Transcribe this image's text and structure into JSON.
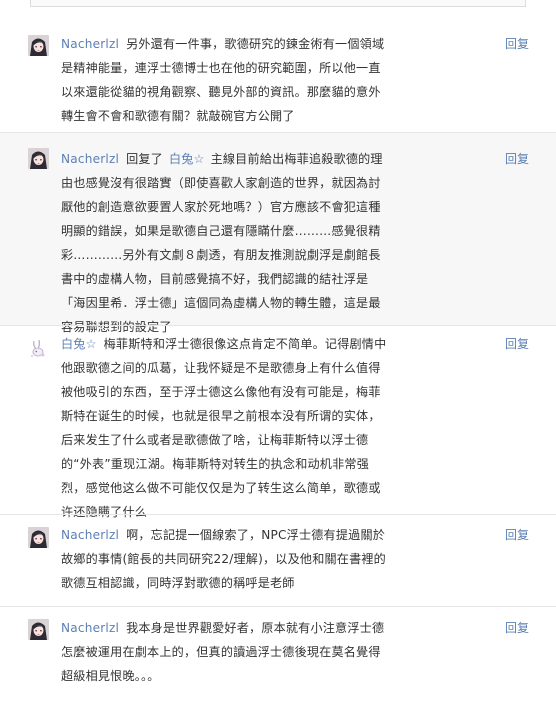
{
  "comments": [
    {
      "author": "Nacherlzl",
      "text": "另外還有一件事，歌德研究的鍊金術有一個領域是精神能量，連浮士德博士也在他的研究範圍，所以他一直以來還能從貓的視角觀察、聽見外部的資訊。那麼貓的意外轉生會不會和歌德有關？就敲碗官方公開了",
      "reply": "回复"
    },
    {
      "author": "Nacherlzl",
      "reply_word": "回复了",
      "reply_to": "白兔☆",
      "text": "主線目前給出梅菲追殺歌德的理由也感覺沒有很踏實（即使喜歡人家創造的世界，就因為討厭他的創造意欲要置人家於死地嗎？）官方應該不會犯這種明顯的錯誤，如果是歌德自己還有隱瞞什麼………感覺很精彩…………另外有文劇８劇透，有朋友推測說劇浮是劇館長書中的虛構人物，目前感覺搞不好，我們認識的結社浮是「海因里希．浮士德」這個同為虛構人物的轉生體，這是最容易聯想到的設定了",
      "reply": "回复"
    },
    {
      "author": "白兔☆",
      "text": "梅菲斯特和浮士德很像这点肯定不简单。记得剧情中他跟歌德之间的瓜葛，让我怀疑是不是歌德身上有什么值得被他吸引的东西，至于浮士德这么像他有没有可能是，梅菲斯特在诞生的时候，也就是很早之前根本没有所谓的实体，后来发生了什么或者是歌德做了啥，让梅菲斯特以浮士德的“外表”重现江湖。梅菲斯特对转生的执念和动机非常强烈，感觉他这么做不可能仅仅是为了转生这么简单，歌德或许还隐瞒了什么",
      "reply": "回复"
    },
    {
      "author": "Nacherlzl",
      "text": "啊，忘記提一個線索了，NPC浮士德有提過關於故鄉的事情(館長的共同研究22/理解)，以及他和關在書裡的歌德互相認識，同時浮對歌德的稱呼是老師",
      "reply": "回复"
    },
    {
      "author": "Nacherlzl",
      "text": "我本身是世界觀愛好者，原本就有小注意浮士德怎麼被運用在劇本上的，但真的讀過浮士德後現在莫名覺得超級相見恨晚。。。",
      "reply": "回复"
    }
  ]
}
